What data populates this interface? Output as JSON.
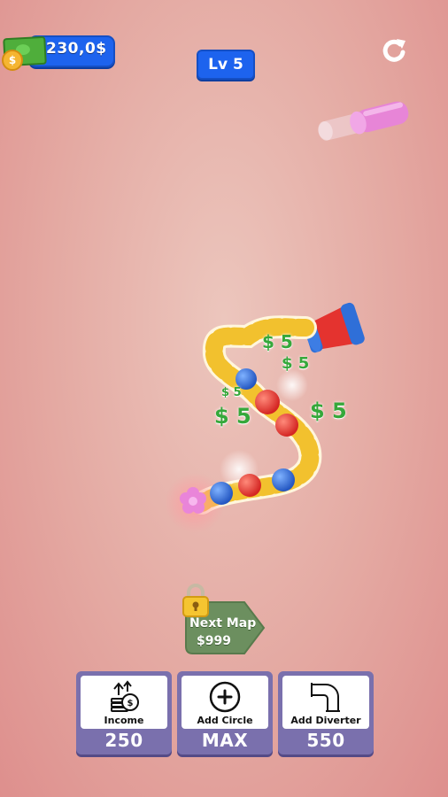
{
  "hud": {
    "money": "230,0$",
    "coin_symbol": "$",
    "level": "Lv  5"
  },
  "floating_dollars": [
    "$ 5",
    "$ 5",
    "$ 5",
    "$ 5",
    "$ 5"
  ],
  "next_map": {
    "label": "Next Map",
    "price": "$999"
  },
  "upgrades": [
    {
      "title": "Income",
      "value": "250",
      "icon": "income-coins-icon"
    },
    {
      "title": "Add Circle",
      "value": "MAX",
      "icon": "plus-circle-icon"
    },
    {
      "title": "Add Diverter",
      "value": "550",
      "icon": "elbow-pipe-icon"
    }
  ],
  "colors": {
    "hud_blue": "#1d63ee",
    "card_purple": "#7a70ad",
    "track_yellow": "#f2c12e",
    "ball_red": "#e4332f",
    "ball_blue": "#2f6fd8",
    "money_green": "#35a83b"
  }
}
